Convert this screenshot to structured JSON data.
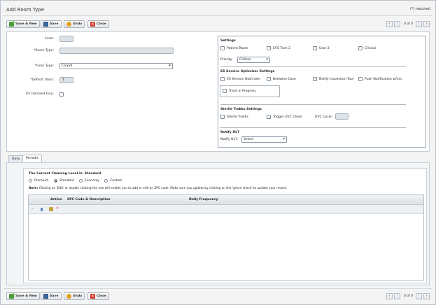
{
  "window": {
    "title": "Add Room Type",
    "required_note": "(*) required"
  },
  "toolbar": {
    "save_new": "Save & New",
    "save": "Save",
    "undo": "Undo",
    "close": "Close",
    "pager_text": "0 of 0",
    "first_icon": "double-chevron-left-icon",
    "prev_icon": "chevron-left-icon",
    "next_icon": "chevron-right-icon",
    "last_icon": "double-chevron-right-icon"
  },
  "form": {
    "code_label": "Code:",
    "code_value": "",
    "room_type_label": "*Room Type:",
    "room_type_value": "",
    "floor_type_label": "*Floor Type:",
    "floor_type_value": "Carpet",
    "default_units_label": "*Default Units:",
    "default_units_value": "1",
    "on_demand_label": "On Demand Insp:",
    "on_demand_checked": false
  },
  "settings": {
    "title": "Settings",
    "checks": [
      {
        "label": "Patient Room",
        "checked": false
      },
      {
        "label": "EVS Tech 2",
        "checked": false
      },
      {
        "label": "User 2",
        "checked": false
      },
      {
        "label": "Clinical",
        "checked": false
      }
    ],
    "priority_label": "Priority:",
    "priority_value": "Critical"
  },
  "es_optimizer": {
    "title": "ES Service Optimizer Settings",
    "checks": [
      {
        "label": "ES Service Optimizer",
        "checked": false
      },
      {
        "label": "Between Case",
        "checked": false
      },
      {
        "label": "Notify Inspection Tool",
        "checked": false
      },
      {
        "label": "Push Notification w/Cm",
        "checked": false
      }
    ],
    "track_label": "Track in Progress"
  },
  "sterile": {
    "title": "Sterile Trakks Settings",
    "checks": [
      {
        "label": "Sterile Trakks",
        "checked": false
      },
      {
        "label": "Trigger UVC Clean",
        "checked": false
      }
    ],
    "uvc_label": "UVC Cycle:",
    "uvc_value": ""
  },
  "notify": {
    "title": "Notify HL7",
    "label": "Notify HL7:",
    "value": "Select"
  },
  "tabs": [
    {
      "label": "Daily",
      "active": false
    },
    {
      "label": "Periodic",
      "active": true
    }
  ],
  "cleaning": {
    "title": "The Current Cleaning Level is: Standard",
    "levels": [
      {
        "label": "Premium",
        "selected": false
      },
      {
        "label": "Standard",
        "selected": true
      },
      {
        "label": "Economy",
        "selected": false
      },
      {
        "label": "Custom",
        "selected": false
      }
    ],
    "note_prefix": "Note:",
    "note_text": "Clicking on 'Edit' or double clicking the row will enable you to add or edit an SPC code. Make sure you update by clicking on the 'green check' to update your record."
  },
  "grid": {
    "columns": [
      "Action",
      "SPC Code & Description",
      "Daily Frequency"
    ],
    "row_icons": [
      "expand-arrow-icon",
      "delete-icon",
      "edit-icon",
      "cancel-icon"
    ]
  },
  "colors": {
    "frame_border": "#b9c4cf",
    "button_gradient_top": "#fdfdfd",
    "close_icon": "#d23a2a",
    "save_icon": "#3d6aa6",
    "new_icon": "#4a9a3a",
    "undo_icon": "#e0a020"
  }
}
